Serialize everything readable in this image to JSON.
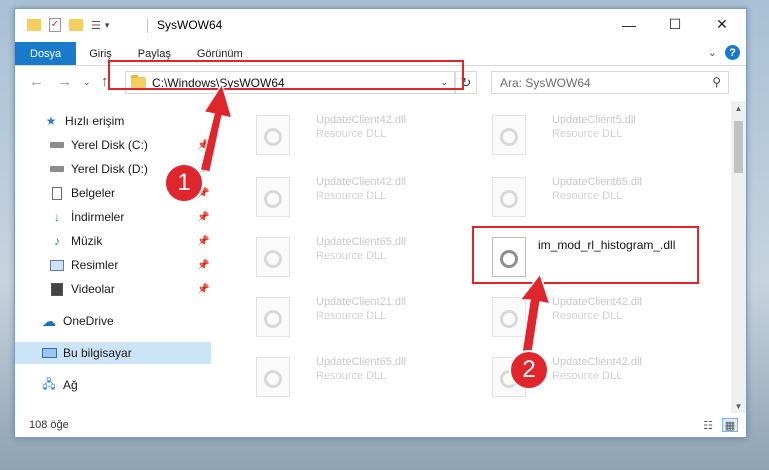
{
  "window": {
    "title": "SysWOW64",
    "controls": {
      "minimize": "—",
      "maximize": "☐",
      "close": "✕"
    }
  },
  "ribbon": {
    "tabs": [
      "Dosya",
      "Giriş",
      "Paylaş",
      "Görünüm"
    ],
    "active_tab": "Dosya",
    "accent_color": "#1979ca",
    "help": "?"
  },
  "nav": {
    "address": "C:\\Windows\\SysWOW64",
    "search_placeholder": "Ara: SysWOW64"
  },
  "sidebar": {
    "items": [
      {
        "label": "Hızlı erişim",
        "icon": "star-icon",
        "pinned": false
      },
      {
        "label": "Yerel Disk (C:)",
        "icon": "drive-icon",
        "pinned": true
      },
      {
        "label": "Yerel Disk (D:)",
        "icon": "drive-icon",
        "pinned": true
      },
      {
        "label": "Belgeler",
        "icon": "document-icon",
        "pinned": true
      },
      {
        "label": "İndirmeler",
        "icon": "download-icon",
        "pinned": true
      },
      {
        "label": "Müzik",
        "icon": "music-icon",
        "pinned": true
      },
      {
        "label": "Resimler",
        "icon": "image-icon",
        "pinned": true
      },
      {
        "label": "Videolar",
        "icon": "video-icon",
        "pinned": true
      },
      {
        "label": "OneDrive",
        "icon": "cloud-icon",
        "pinned": false
      },
      {
        "label": "Bu bilgisayar",
        "icon": "computer-icon",
        "pinned": false,
        "selected": true
      },
      {
        "label": "Ağ",
        "icon": "network-icon",
        "pinned": false
      }
    ]
  },
  "files": [
    {
      "name": "UpdateClient42.dll",
      "desc": "Resource DLL"
    },
    {
      "name": "UpdateClient5.dll",
      "desc": "Resource DLL"
    },
    {
      "name": "UpdateClient42.dll",
      "desc": "Resource DLL"
    },
    {
      "name": "UpdateClient65.dll",
      "desc": "Resource DLL"
    },
    {
      "name": "UpdateClient65.dll",
      "desc": "Resource DLL"
    },
    {
      "name": "im_mod_rl_histogram_.dll",
      "desc": "",
      "highlighted": true
    },
    {
      "name": "UpdateClient21.dll",
      "desc": "Resource DLL"
    },
    {
      "name": "UpdateClient42.dll",
      "desc": "Resource DLL"
    },
    {
      "name": "UpdateClient65.dll",
      "desc": "Resource DLL"
    },
    {
      "name": "UpdateClient42.dll",
      "desc": "Resource DLL"
    }
  ],
  "status": {
    "item_count": "108 öğe"
  },
  "annotations": {
    "callout_1": "1",
    "callout_2": "2",
    "highlight_color": "#e0262d"
  }
}
